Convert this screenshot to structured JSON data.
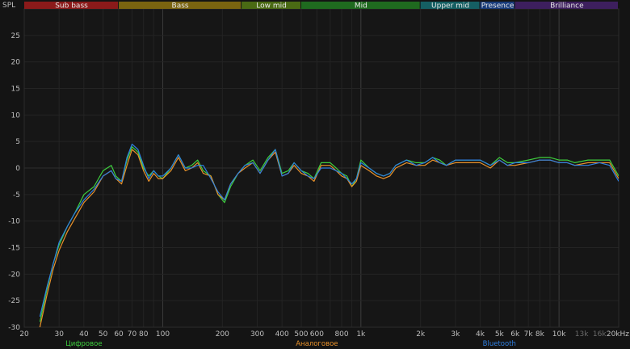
{
  "chart_data": {
    "type": "line",
    "ylabel": "SPL",
    "xscale": "log",
    "xlim": [
      20,
      20000
    ],
    "ylim": [
      -30,
      30
    ],
    "grid": true,
    "x_ticks": [
      {
        "value": 20,
        "label": "20"
      },
      {
        "value": 30,
        "label": "30"
      },
      {
        "value": 40,
        "label": "40"
      },
      {
        "value": 50,
        "label": "50"
      },
      {
        "value": 60,
        "label": "60"
      },
      {
        "value": 70,
        "label": "70"
      },
      {
        "value": 80,
        "label": "80"
      },
      {
        "value": 100,
        "label": "100"
      },
      {
        "value": 200,
        "label": "200"
      },
      {
        "value": 300,
        "label": "300"
      },
      {
        "value": 400,
        "label": "400"
      },
      {
        "value": 500,
        "label": "500"
      },
      {
        "value": 600,
        "label": "600"
      },
      {
        "value": 800,
        "label": "800"
      },
      {
        "value": 1000,
        "label": "1k"
      },
      {
        "value": 2000,
        "label": "2k"
      },
      {
        "value": 3000,
        "label": "3k"
      },
      {
        "value": 4000,
        "label": "4k"
      },
      {
        "value": 5000,
        "label": "5k"
      },
      {
        "value": 6000,
        "label": "6k"
      },
      {
        "value": 7000,
        "label": "7k"
      },
      {
        "value": 8000,
        "label": "8k"
      },
      {
        "value": 10000,
        "label": "10k"
      },
      {
        "value": 13000,
        "label": "13k",
        "dim": true
      },
      {
        "value": 16000,
        "label": "16k",
        "dim": true
      },
      {
        "value": 20000,
        "label": "20kHz"
      }
    ],
    "y_ticks": [
      25,
      20,
      15,
      10,
      5,
      0,
      -5,
      -10,
      -15,
      -20,
      -25,
      -30
    ],
    "bands": [
      {
        "label": "Sub bass",
        "from": 20,
        "to": 60,
        "color": "#8b1a1a"
      },
      {
        "label": "Bass",
        "from": 60,
        "to": 250,
        "color": "#7a6410"
      },
      {
        "label": "Low mid",
        "from": 250,
        "to": 500,
        "color": "#4a6a14"
      },
      {
        "label": "Mid",
        "from": 500,
        "to": 2000,
        "color": "#1f6a1f"
      },
      {
        "label": "Upper mid",
        "from": 2000,
        "to": 4000,
        "color": "#155f63"
      },
      {
        "label": "Presence",
        "from": 4000,
        "to": 6000,
        "color": "#183b7a"
      },
      {
        "label": "Brilliance",
        "from": 6000,
        "to": 20000,
        "color": "#3d1f5e"
      }
    ],
    "series": [
      {
        "name": "Цифровое",
        "color": "#3ecf3e",
        "x": [
          24,
          26,
          28,
          30,
          33,
          36,
          40,
          45,
          50,
          55,
          58,
          62,
          66,
          70,
          75,
          80,
          85,
          90,
          95,
          100,
          110,
          120,
          130,
          140,
          150,
          160,
          175,
          190,
          205,
          220,
          240,
          260,
          285,
          310,
          340,
          370,
          400,
          430,
          460,
          500,
          540,
          580,
          630,
          700,
          750,
          800,
          850,
          900,
          950,
          1000,
          1100,
          1200,
          1300,
          1400,
          1500,
          1700,
          1900,
          2100,
          2300,
          2500,
          2700,
          3000,
          3500,
          4000,
          4500,
          5000,
          5500,
          6000,
          7000,
          8000,
          9000,
          10000,
          11000,
          12000,
          14000,
          16000,
          18000,
          20000
        ],
        "y": [
          -29,
          -23,
          -18,
          -14.5,
          -11,
          -8.5,
          -5,
          -3.5,
          -0.5,
          0.5,
          -1.5,
          -2.5,
          1.5,
          4,
          3,
          0,
          -1.5,
          -0.5,
          -1.5,
          -2,
          0,
          2.5,
          0,
          0.5,
          1.5,
          -0.5,
          -1.5,
          -5,
          -6.5,
          -3.5,
          -1,
          0.5,
          1.5,
          -0.5,
          2,
          3.5,
          -1,
          -0.5,
          1,
          -0.5,
          -1,
          -2,
          1,
          1,
          0,
          -1,
          -1.5,
          -3.5,
          -2,
          1.5,
          0,
          -1,
          -1.5,
          -1,
          0.5,
          1.5,
          1,
          1,
          2,
          1.5,
          0.5,
          1.5,
          1.5,
          1.5,
          0.5,
          2,
          1,
          1,
          1.5,
          2,
          2,
          1.5,
          1.5,
          1,
          1.5,
          1.5,
          1.5,
          -1.5
        ]
      },
      {
        "name": "Аналоговое",
        "color": "#e8912a",
        "x": [
          24,
          26,
          28,
          30,
          33,
          36,
          40,
          45,
          50,
          55,
          58,
          62,
          66,
          70,
          75,
          80,
          85,
          90,
          95,
          100,
          110,
          120,
          130,
          140,
          150,
          160,
          175,
          190,
          205,
          220,
          240,
          260,
          285,
          310,
          340,
          370,
          400,
          430,
          460,
          500,
          540,
          580,
          630,
          700,
          750,
          800,
          850,
          900,
          950,
          1000,
          1100,
          1200,
          1300,
          1400,
          1500,
          1700,
          1900,
          2100,
          2300,
          2500,
          2700,
          3000,
          3500,
          4000,
          4500,
          5000,
          5500,
          6000,
          7000,
          8000,
          9000,
          10000,
          11000,
          12000,
          14000,
          16000,
          18000,
          20000
        ],
        "y": [
          -30,
          -24,
          -19,
          -15.5,
          -12,
          -9.5,
          -6.5,
          -4.5,
          -1.5,
          -0.5,
          -2,
          -3,
          0.5,
          3.5,
          2.5,
          -0.5,
          -2.5,
          -1,
          -2,
          -2,
          -0.5,
          2,
          -0.5,
          0,
          1,
          -1,
          -1.5,
          -5,
          -6,
          -3,
          -1,
          0,
          1,
          -1,
          1.5,
          3,
          -1.5,
          -1,
          0.5,
          -1,
          -1.5,
          -2.5,
          0.5,
          0.5,
          -0.5,
          -1.5,
          -2,
          -3.5,
          -2.5,
          0.5,
          -0.5,
          -1.5,
          -2,
          -1.5,
          0,
          1,
          0.5,
          0.5,
          1.5,
          1,
          0.5,
          1,
          1,
          1,
          0,
          1.5,
          0.5,
          0.5,
          1,
          1.5,
          1.5,
          1,
          1,
          0.5,
          1,
          1,
          1,
          -2
        ]
      },
      {
        "name": "Bluetooth",
        "color": "#2f7fe0",
        "x": [
          24,
          26,
          28,
          30,
          33,
          36,
          40,
          45,
          50,
          55,
          58,
          62,
          66,
          70,
          75,
          80,
          85,
          90,
          95,
          100,
          110,
          120,
          130,
          140,
          150,
          160,
          175,
          190,
          205,
          220,
          240,
          260,
          285,
          310,
          340,
          370,
          400,
          430,
          460,
          500,
          540,
          580,
          630,
          700,
          750,
          800,
          850,
          900,
          950,
          1000,
          1100,
          1200,
          1300,
          1400,
          1500,
          1700,
          1900,
          2100,
          2300,
          2500,
          2700,
          3000,
          3500,
          4000,
          4500,
          5000,
          5500,
          6000,
          7000,
          8000,
          9000,
          10000,
          11000,
          12000,
          14000,
          16000,
          18000,
          20000
        ],
        "y": [
          -28,
          -22.5,
          -18,
          -14,
          -11,
          -8.5,
          -6,
          -4,
          -1.5,
          -0.5,
          -2,
          -2.5,
          2,
          4.5,
          3.5,
          0.5,
          -2,
          -0.5,
          -1.5,
          -1.5,
          0,
          2.5,
          0,
          0,
          0.5,
          0.5,
          -2,
          -4.5,
          -6,
          -3,
          -1,
          0.5,
          1,
          -1,
          1.5,
          3.5,
          -1.5,
          -1,
          1,
          -0.5,
          -1.5,
          -2,
          0,
          0,
          -0.5,
          -1,
          -2,
          -3,
          -2,
          1,
          0,
          -1,
          -1.5,
          -1,
          0.5,
          1.5,
          0.5,
          1,
          2,
          1,
          0.5,
          1.5,
          1.5,
          1.5,
          0.5,
          1.5,
          0.5,
          1,
          1,
          1.5,
          1.5,
          1,
          1,
          0.5,
          0.5,
          1,
          0.5,
          -2.5
        ]
      }
    ]
  }
}
